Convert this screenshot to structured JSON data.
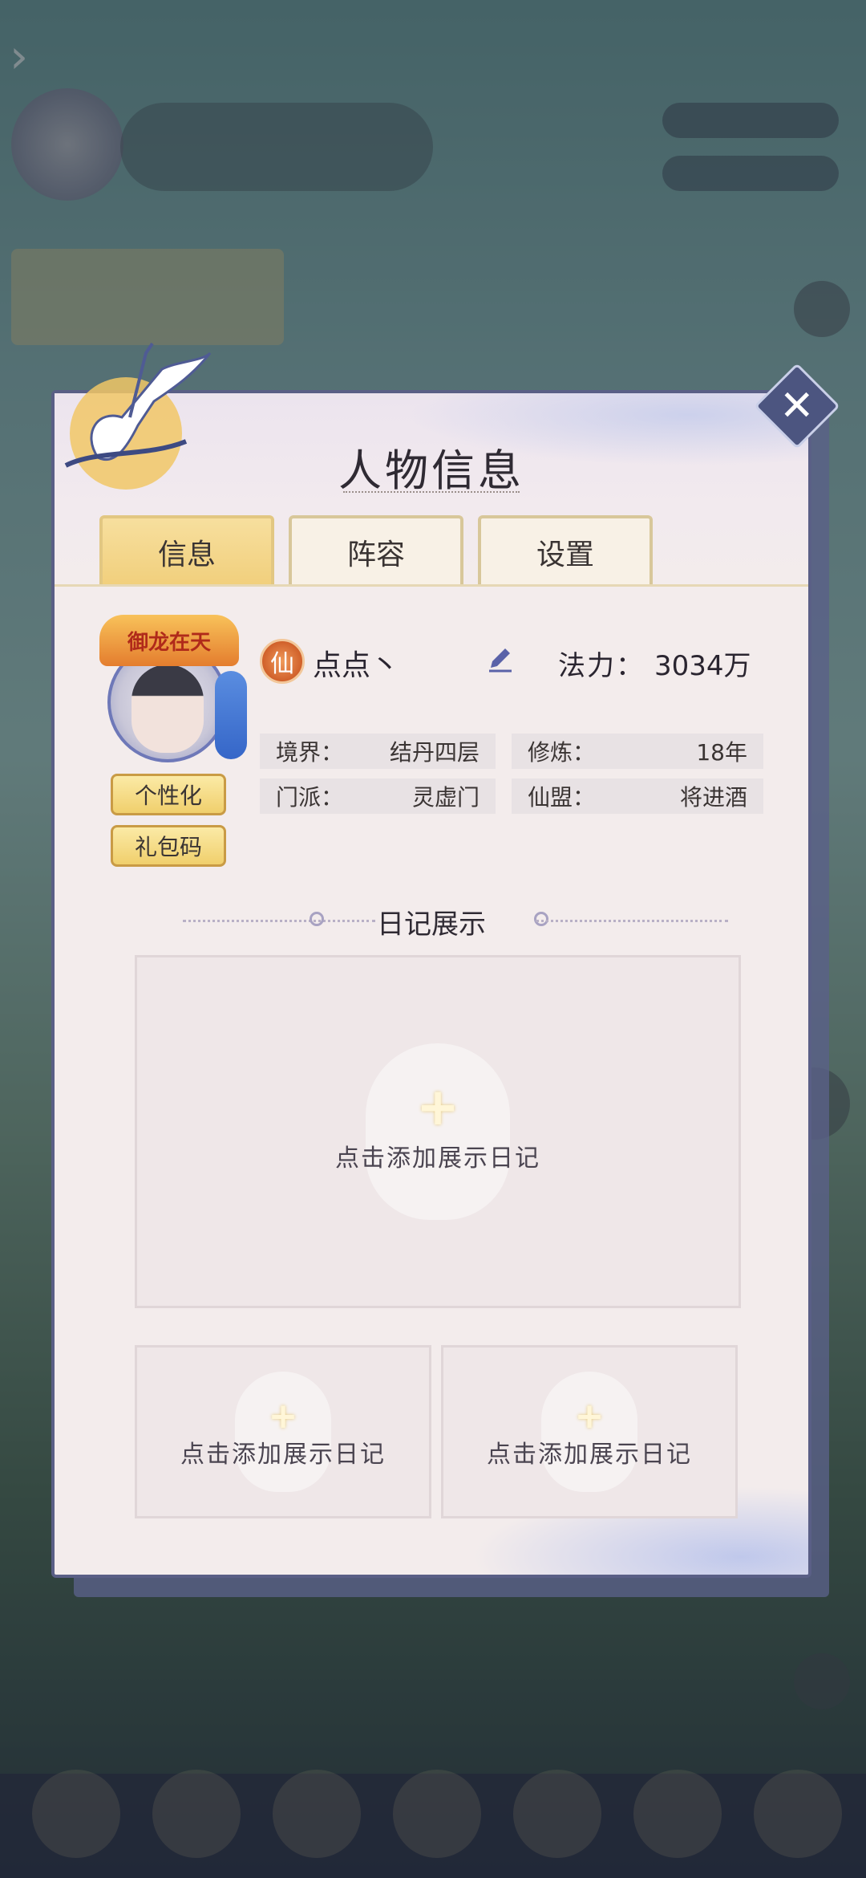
{
  "background": {
    "back_glyph": "›"
  },
  "panel": {
    "title": "人物信息",
    "close_glyph": "✕",
    "tabs": [
      {
        "label": "信息",
        "active": true
      },
      {
        "label": "阵容",
        "active": false
      },
      {
        "label": "设置",
        "active": false
      }
    ]
  },
  "profile": {
    "crest_text": "御龙在天",
    "immortal_badge": "仙",
    "name": "点点丶",
    "power_label": "法力：",
    "power_value": "3034万",
    "buttons": {
      "personalize": "个性化",
      "gift_code": "礼包码"
    },
    "info": {
      "realm_label": "境界：",
      "realm_value": "结丹四层",
      "cultivation_label": "修炼：",
      "cultivation_value": "18年",
      "sect_label": "门派：",
      "sect_value": "灵虚门",
      "alliance_label": "仙盟：",
      "alliance_value": "将进酒"
    }
  },
  "diary": {
    "section_title": "日记展示",
    "main_slot_text": "点击添加展示日记",
    "left_slot_text": "点击添加展示日记",
    "right_slot_text": "点击添加展示日记",
    "plus_glyph": "+"
  },
  "colors": {
    "panel_border": "#5a5f86",
    "tab_active": "#f1cf7c",
    "button_gold": "#f0cf6c"
  }
}
